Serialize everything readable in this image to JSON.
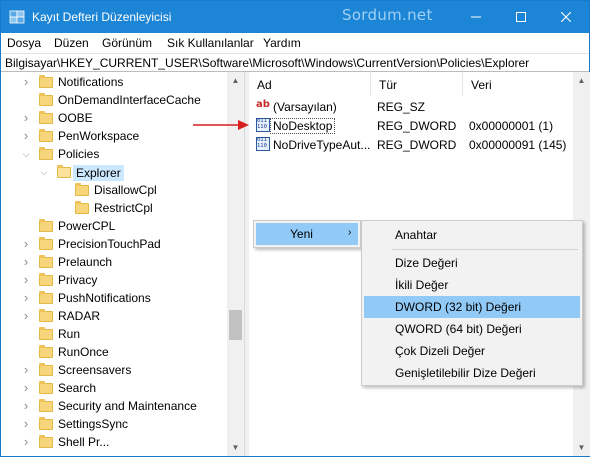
{
  "window": {
    "title": "Kayıt Defteri Düzenleyicisi",
    "watermark": "Sordum.net",
    "accent": "#1d85d6"
  },
  "menubar": {
    "items": [
      {
        "label": "Dosya"
      },
      {
        "label": "Düzen"
      },
      {
        "label": "Görünüm"
      },
      {
        "label": "Sık Kullanılanlar"
      },
      {
        "label": "Yardım"
      }
    ]
  },
  "address": "Bilgisayar\\HKEY_CURRENT_USER\\Software\\Microsoft\\Windows\\CurrentVersion\\Policies\\Explorer",
  "tree": {
    "items": [
      {
        "label": "Notifications",
        "expander": "collapsed"
      },
      {
        "label": "OnDemandInterfaceCache",
        "expander": "none"
      },
      {
        "label": "OOBE",
        "expander": "collapsed"
      },
      {
        "label": "PenWorkspace",
        "expander": "collapsed"
      },
      {
        "label": "Policies",
        "expander": "expanded"
      },
      {
        "label": "Explorer",
        "expander": "expanded",
        "selected": true
      },
      {
        "label": "DisallowCpl",
        "expander": "none"
      },
      {
        "label": "RestrictCpl",
        "expander": "none"
      },
      {
        "label": "PowerCPL",
        "expander": "none"
      },
      {
        "label": "PrecisionTouchPad",
        "expander": "collapsed"
      },
      {
        "label": "Prelaunch",
        "expander": "collapsed"
      },
      {
        "label": "Privacy",
        "expander": "collapsed"
      },
      {
        "label": "PushNotifications",
        "expander": "collapsed"
      },
      {
        "label": "RADAR",
        "expander": "collapsed"
      },
      {
        "label": "Run",
        "expander": "none"
      },
      {
        "label": "RunOnce",
        "expander": "none"
      },
      {
        "label": "Screensavers",
        "expander": "collapsed"
      },
      {
        "label": "Search",
        "expander": "collapsed"
      },
      {
        "label": "Security and Maintenance",
        "expander": "collapsed"
      },
      {
        "label": "SettingsSync",
        "expander": "collapsed"
      },
      {
        "label": "Shell Pr...",
        "expander": "collapsed"
      }
    ]
  },
  "values": {
    "headers": {
      "name": "Ad",
      "type": "Tür",
      "data": "Veri"
    },
    "rows": [
      {
        "icon": "string-value-icon",
        "name": "(Varsayılan)",
        "type": "REG_SZ",
        "data": ""
      },
      {
        "icon": "dword-value-icon",
        "name": "NoDesktop",
        "type": "REG_DWORD",
        "data": "0x00000001 (1)",
        "focused": true
      },
      {
        "icon": "dword-value-icon",
        "name": "NoDriveTypeAut...",
        "type": "REG_DWORD",
        "data": "0x00000091 (145)"
      }
    ]
  },
  "context_menu": {
    "new_label": "Yeni",
    "submenu": {
      "key": "Anahtar",
      "items": [
        {
          "label": "Dize Değeri"
        },
        {
          "label": "İkili Değer"
        },
        {
          "label": "DWORD (32 bit) Değeri",
          "highlighted": true
        },
        {
          "label": "QWORD (64 bit) Değeri"
        },
        {
          "label": "Çok Dizeli Değer"
        },
        {
          "label": "Genişletilebilir Dize Değeri"
        }
      ]
    }
  },
  "highlight_color": "#91c9f7",
  "annotation_arrow_color": "#d81e1e"
}
